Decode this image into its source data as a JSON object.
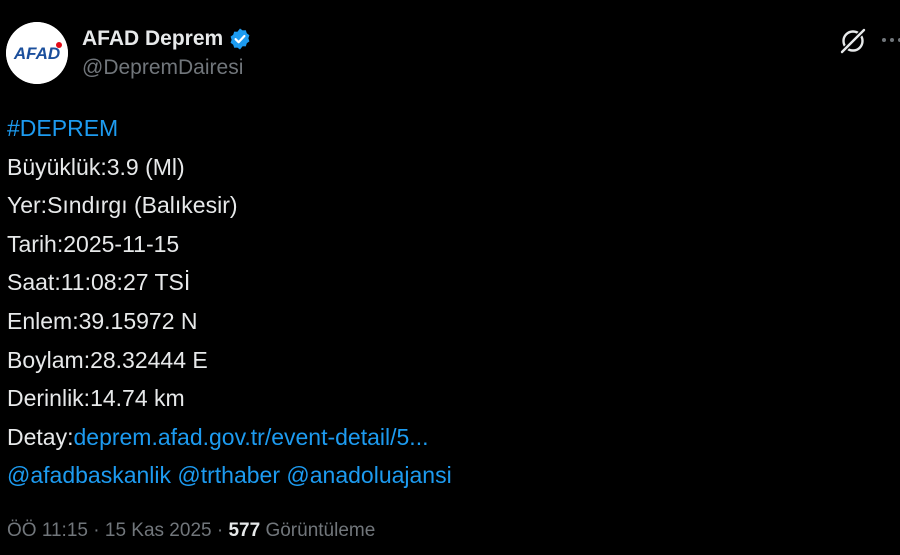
{
  "author": {
    "display_name": "AFAD Deprem",
    "handle": "@DepremDairesi",
    "avatar_text": "AFAD",
    "verified": true
  },
  "tweet": {
    "hashtag": "#DEPREM",
    "lines": [
      "Büyüklük:3.9 (Ml)",
      "Yer:Sındırgı (Balıkesir)",
      "Tarih:2025-11-15",
      "Saat:11:08:27 TSİ",
      "Enlem:39.15972 N",
      "Boylam:28.32444 E",
      "Derinlik:14.74 km"
    ],
    "detail_label": "Detay:",
    "detail_link": "deprem.afad.gov.tr/event-detail/5...",
    "mentions": [
      "@afadbaskanlik",
      "@trthaber",
      "@anadoluajansi"
    ]
  },
  "meta": {
    "time": "ÖÖ 11:15",
    "separator": "·",
    "date": "15 Kas 2025",
    "views_count": "577",
    "views_label": "Görüntüleme"
  },
  "colors": {
    "background": "#000000",
    "text": "#e7e9ea",
    "secondary": "#71767b",
    "link": "#1d9bf0",
    "brand_blue": "#1b4f9c",
    "brand_red": "#e30a17"
  },
  "icons": {
    "verified": "verified-badge-icon",
    "grok": "grok-icon",
    "more": "more-icon"
  }
}
